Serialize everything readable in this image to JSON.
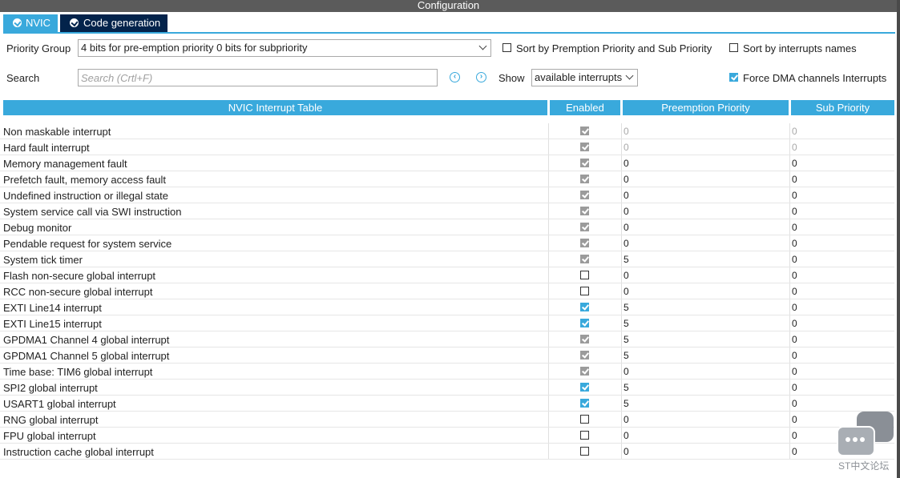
{
  "window": {
    "title": "Configuration"
  },
  "tabs": [
    {
      "label": "NVIC",
      "active": true,
      "icon": "check-circle-icon"
    },
    {
      "label": "Code generation",
      "active": false,
      "icon": "check-circle-icon"
    }
  ],
  "controls": {
    "priority_group_label": "Priority Group",
    "priority_group_value": "4 bits for pre-emption priority 0 bits for subpriority",
    "sort_premption_label": "Sort by Premption Priority and Sub Priority",
    "sort_premption_checked": false,
    "sort_names_label": "Sort by interrupts names",
    "sort_names_checked": false,
    "search_label": "Search",
    "search_placeholder": "Search (Crtl+F)",
    "search_value": "",
    "show_label": "Show",
    "show_value": "available interrupts",
    "force_dma_label": "Force DMA channels Interrupts",
    "force_dma_checked": true
  },
  "table": {
    "headers": {
      "name": "NVIC Interrupt Table",
      "enabled": "Enabled",
      "preemption": "Preemption Priority",
      "sub": "Sub Priority"
    },
    "rows": [
      {
        "name": "Non maskable interrupt",
        "enabled": "disabled-checked",
        "preemption": "0",
        "sub": "0",
        "locked": true
      },
      {
        "name": "Hard fault interrupt",
        "enabled": "disabled-checked",
        "preemption": "0",
        "sub": "0",
        "locked": true
      },
      {
        "name": "Memory management fault",
        "enabled": "disabled-checked",
        "preemption": "0",
        "sub": "0",
        "locked": false
      },
      {
        "name": "Prefetch fault, memory access fault",
        "enabled": "disabled-checked",
        "preemption": "0",
        "sub": "0",
        "locked": false
      },
      {
        "name": "Undefined instruction or illegal state",
        "enabled": "disabled-checked",
        "preemption": "0",
        "sub": "0",
        "locked": false
      },
      {
        "name": "System service call via SWI instruction",
        "enabled": "disabled-checked",
        "preemption": "0",
        "sub": "0",
        "locked": false
      },
      {
        "name": "Debug monitor",
        "enabled": "disabled-checked",
        "preemption": "0",
        "sub": "0",
        "locked": false
      },
      {
        "name": "Pendable request for system service",
        "enabled": "disabled-checked",
        "preemption": "0",
        "sub": "0",
        "locked": false
      },
      {
        "name": "System tick timer",
        "enabled": "disabled-checked",
        "preemption": "5",
        "sub": "0",
        "locked": false
      },
      {
        "name": "Flash non-secure global interrupt",
        "enabled": "unchecked",
        "preemption": "0",
        "sub": "0",
        "locked": false
      },
      {
        "name": "RCC non-secure global interrupt",
        "enabled": "unchecked",
        "preemption": "0",
        "sub": "0",
        "locked": false
      },
      {
        "name": "EXTI Line14 interrupt",
        "enabled": "checked",
        "preemption": "5",
        "sub": "0",
        "locked": false
      },
      {
        "name": "EXTI Line15 interrupt",
        "enabled": "checked",
        "preemption": "5",
        "sub": "0",
        "locked": false
      },
      {
        "name": "GPDMA1 Channel 4 global interrupt",
        "enabled": "disabled-checked",
        "preemption": "5",
        "sub": "0",
        "locked": false
      },
      {
        "name": "GPDMA1 Channel 5 global interrupt",
        "enabled": "disabled-checked",
        "preemption": "5",
        "sub": "0",
        "locked": false
      },
      {
        "name": "Time base: TIM6 global interrupt",
        "enabled": "disabled-checked",
        "preemption": "0",
        "sub": "0",
        "locked": false
      },
      {
        "name": "SPI2 global interrupt",
        "enabled": "checked",
        "preemption": "5",
        "sub": "0",
        "locked": false
      },
      {
        "name": "USART1 global interrupt",
        "enabled": "checked",
        "preemption": "5",
        "sub": "0",
        "locked": false
      },
      {
        "name": "RNG global interrupt",
        "enabled": "unchecked",
        "preemption": "0",
        "sub": "0",
        "locked": false
      },
      {
        "name": "FPU global interrupt",
        "enabled": "unchecked",
        "preemption": "0",
        "sub": "0",
        "locked": false
      },
      {
        "name": "Instruction cache global interrupt",
        "enabled": "unchecked",
        "preemption": "0",
        "sub": "0",
        "locked": false
      }
    ]
  },
  "watermark": {
    "text": "ST中文论坛",
    "icon": "chat-bubble-icon"
  },
  "colors": {
    "accent": "#39a9dc",
    "tab_inactive": "#03234b",
    "titlebar": "#5b5b5b"
  }
}
